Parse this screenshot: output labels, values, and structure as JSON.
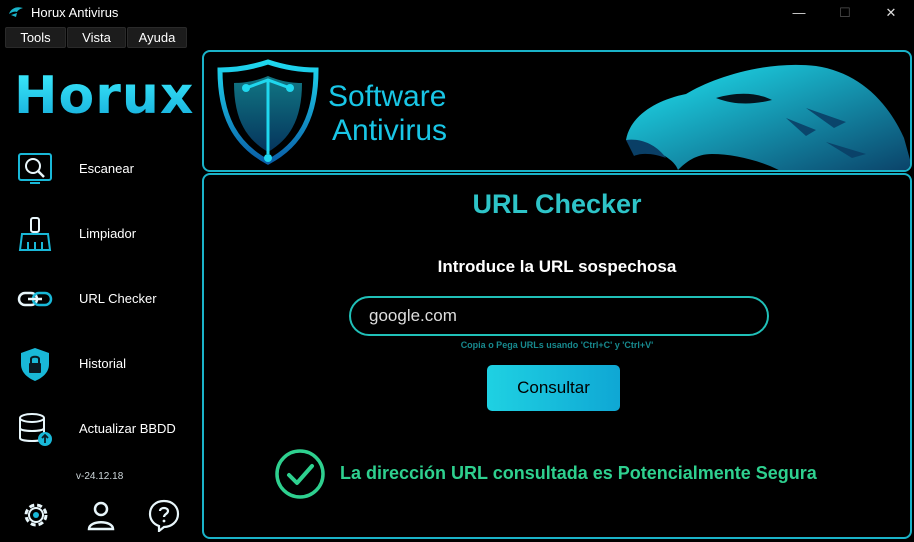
{
  "window": {
    "title": "Horux Antivirus",
    "icon": "eagle-app-icon",
    "controls": {
      "minimize": "—",
      "maximize": "☐",
      "close": "✕"
    }
  },
  "menu": [
    {
      "label": "Tools"
    },
    {
      "label": "Vista"
    },
    {
      "label": "Ayuda"
    }
  ],
  "sidebar": {
    "logo": "Horux",
    "items": [
      {
        "label": "Escanear",
        "icon": "scan-icon"
      },
      {
        "label": "Limpiador",
        "icon": "broom-icon"
      },
      {
        "label": "URL Checker",
        "icon": "link-icon"
      },
      {
        "label": "Historial",
        "icon": "shield-lock-icon"
      },
      {
        "label": "Actualizar BBDD",
        "icon": "database-update-icon"
      }
    ],
    "version": "v-24.12.18",
    "bottom_icons": [
      "gear-icon",
      "user-icon",
      "help-icon"
    ]
  },
  "banner": {
    "brand_line1": "Software",
    "brand_line2": "Antivirus"
  },
  "main": {
    "title": "URL Checker",
    "subtitle": "Introduce la URL sospechosa",
    "input_value": "google.com",
    "hint": "Copia o Pega URLs usando 'Ctrl+C' y 'Ctrl+V'",
    "button_label": "Consultar",
    "result_text": "La dirección URL consultada es Potencialmente Segura",
    "result_icon": "check-circle-icon"
  },
  "colors": {
    "accent": "#1ab3c9",
    "title": "#2ec4c8",
    "success": "#2ed08f",
    "button": "#1fd1e2"
  }
}
